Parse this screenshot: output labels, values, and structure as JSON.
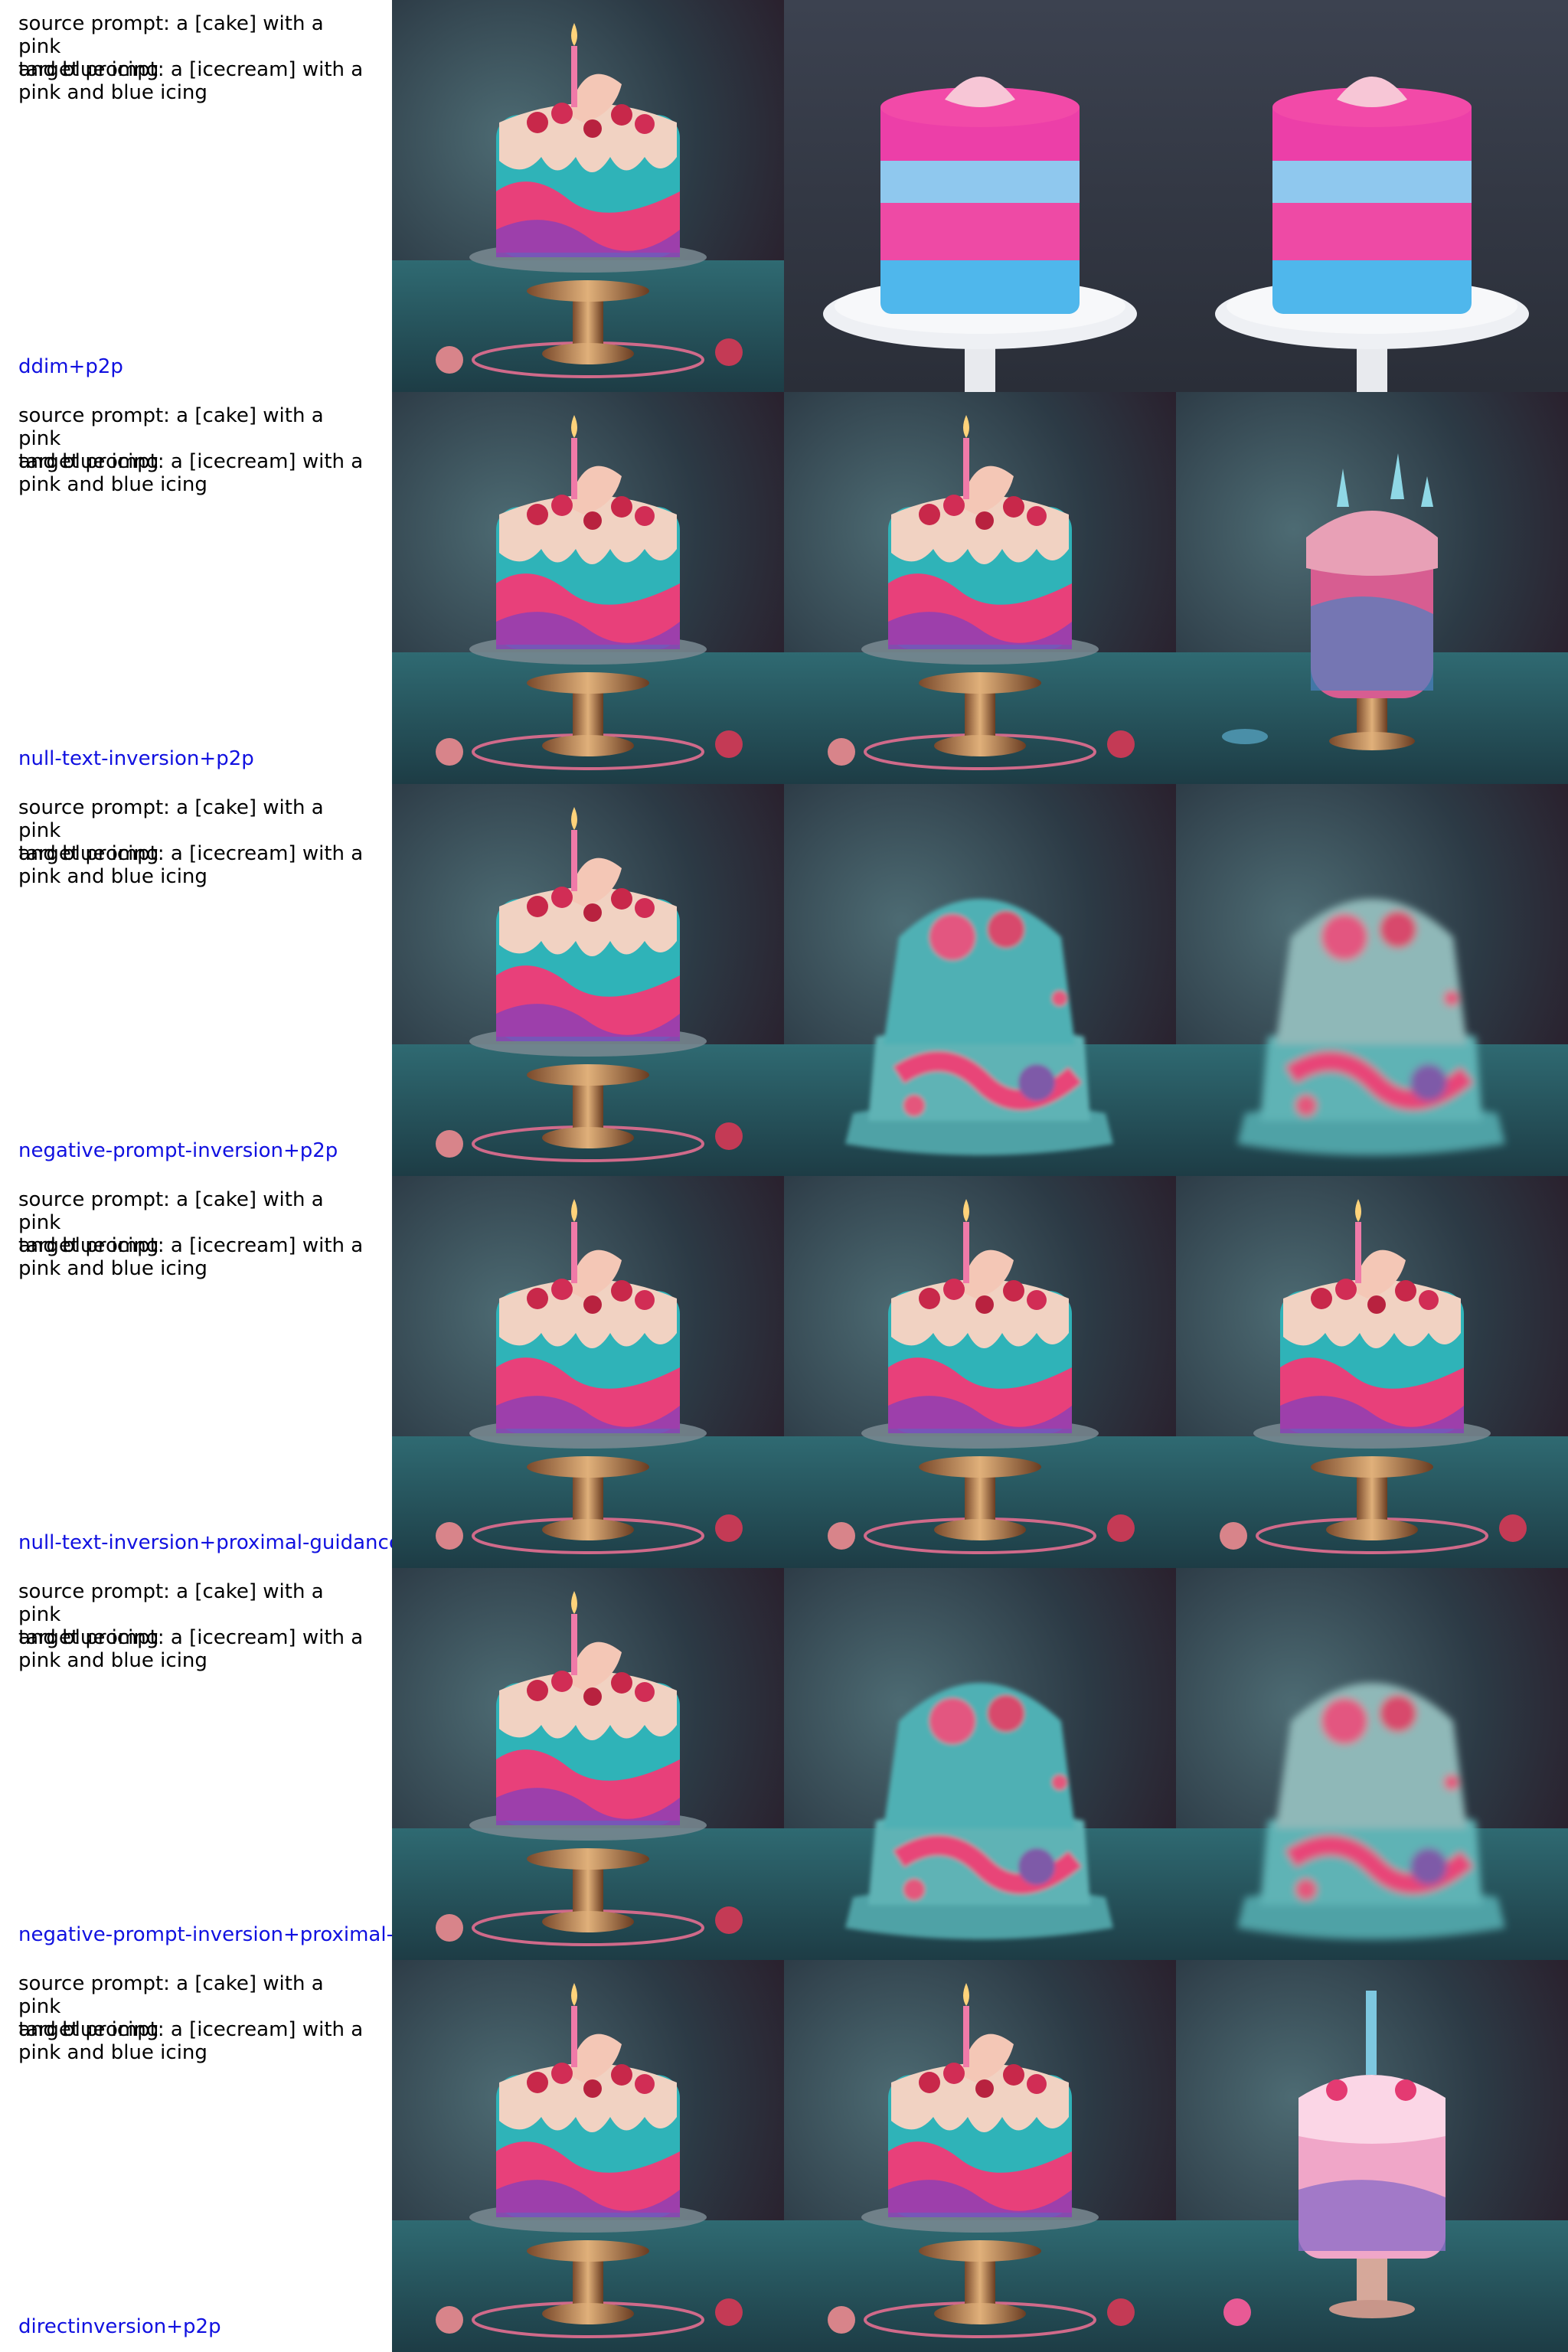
{
  "rows": [
    {
      "source_prompt": "source prompt: a [cake] with a pink\nand blue icing",
      "target_prompt": "target prompt: a [icecream] with a\npink and blue icing",
      "method": "ddim+p2p"
    },
    {
      "source_prompt": "source prompt: a [cake] with a pink\nand blue icing",
      "target_prompt": "target prompt: a [icecream] with a\npink and blue icing",
      "method": "null-text-inversion+p2p"
    },
    {
      "source_prompt": "source prompt: a [cake] with a pink\nand blue icing",
      "target_prompt": "target prompt: a [icecream] with a\npink and blue icing",
      "method": "negative-prompt-inversion+p2p"
    },
    {
      "source_prompt": "source prompt: a [cake] with a pink\nand blue icing",
      "target_prompt": "target prompt: a [icecream] with a\npink and blue icing",
      "method": "null-text-inversion+proximal-guidance"
    },
    {
      "source_prompt": "source prompt: a [cake] with a pink\nand blue icing",
      "target_prompt": "target prompt: a [icecream] with a\npink and blue icing",
      "method": "negative-prompt-inversion+proximal-g"
    },
    {
      "source_prompt": "source prompt: a [cake] with a pink\nand blue icing",
      "target_prompt": "target prompt: a [icecream] with a\npink and blue icing",
      "method": "directinversion+p2p"
    }
  ],
  "colors": {
    "method_label": "#1010e0",
    "prompt_text": "#000000"
  }
}
